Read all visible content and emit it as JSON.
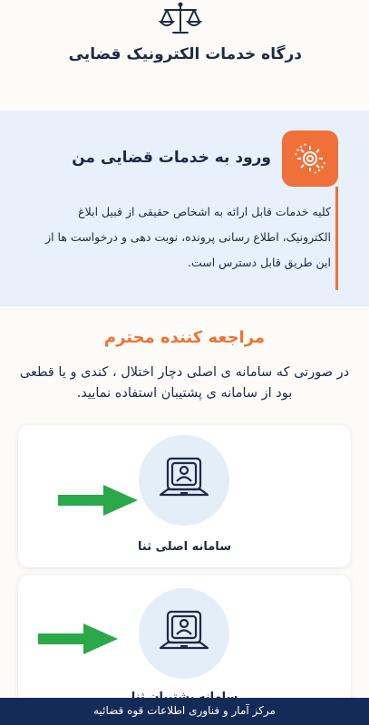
{
  "header": {
    "title": "درگاه خدمات الکترونیک قضایی",
    "logo_icon": "scales-of-justice-icon"
  },
  "login": {
    "icon": "gear-service-icon",
    "title": "ورود به خدمات قضایی من",
    "description": "کلیه خدمات قابل ارائه به اشخاص حقیقی از قبیل ابلاغ الکترونیک، اطلاع رسانی پرونده، نوبت دهی و درخواست ها از این طریق قابل دسترس است."
  },
  "notice": {
    "title": "مراجعه کننده محترم",
    "text": "در صورتی که سامانه ی اصلی دچار اختلال ، کندی و یا قطعی بود از سامانه ی پشتیبان استفاده نمایید."
  },
  "systems": [
    {
      "label": "سامانه اصلی ثنا",
      "icon": "laptop-user-icon"
    },
    {
      "label": "سامانه پشتیبان ثنا",
      "icon": "laptop-user-icon"
    }
  ],
  "footer": {
    "text": "مرکز آمار و فناوری اطلاعات قوه قضائیه"
  },
  "colors": {
    "primary": "#1d2a45",
    "accent": "#ec7434",
    "card_bg": "#e7f0fb",
    "arrow": "#2aa84a",
    "footer_bg": "#152b57"
  }
}
